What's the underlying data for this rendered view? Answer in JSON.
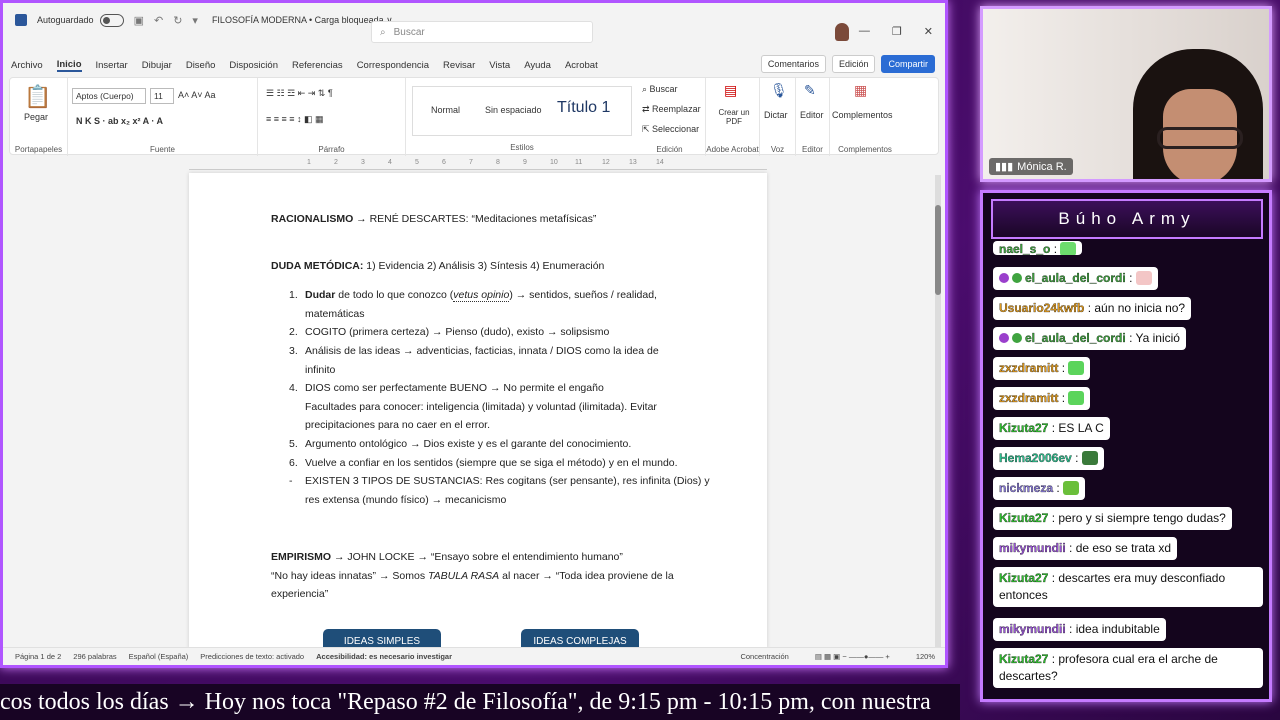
{
  "word": {
    "autosave_label": "Autoguardado",
    "doc_title": "FILOSOFÍA MODERNA • Carga bloqueada ∨",
    "search_placeholder": "Buscar",
    "menus": [
      "Archivo",
      "Inicio",
      "Insertar",
      "Dibujar",
      "Diseño",
      "Disposición",
      "Referencias",
      "Correspondencia",
      "Revisar",
      "Vista",
      "Ayuda",
      "Acrobat"
    ],
    "comments_label": "Comentarios",
    "editing_label": "Edición",
    "share_label": "Compartir",
    "ribbon": {
      "paste": "Pegar",
      "clipboard": "Portapapeles",
      "font_name": "Aptos (Cuerpo)",
      "font_size": "11",
      "font_group": "Fuente",
      "paragraph_group": "Párrafo",
      "style_normal": "Normal",
      "style_nospacing": "Sin espaciado",
      "style_title": "Título 1",
      "styles_group": "Estilos",
      "find": "Buscar",
      "replace": "Reemplazar",
      "select": "Seleccionar",
      "edit_group": "Edición",
      "create_pdf": "Crear un PDF",
      "acrobat_group": "Adobe Acrobat",
      "dictate": "Dictar",
      "voice_group": "Voz",
      "editor": "Editor",
      "editor_group": "Editor",
      "addins": "Complementos",
      "addins_group": "Complementos"
    },
    "ruler": [
      "1",
      "2",
      "3",
      "4",
      "5",
      "6",
      "7",
      "8",
      "9",
      "10",
      "11",
      "12",
      "13",
      "14"
    ],
    "document": {
      "l1_bold": "RACIONALISMO",
      "l1_rest": " → RENÉ DESCARTES: “Meditaciones metafísicas”",
      "l2_bold": "DUDA METÓDICA:",
      "l2_rest": " 1) Evidencia 2) Análisis 3) Síntesis 4) Enumeración",
      "items": [
        {
          "n": "1.",
          "pre_bold": "Dudar",
          "a": " de todo lo que conozco (",
          "italic": "vetus opinio",
          "b": ") → sentidos, sueños / realidad,",
          "cont": "matemáticas"
        },
        {
          "n": "2.",
          "text": "COGITO (primera certeza) → Pienso (dudo), existo → solipsismo"
        },
        {
          "n": "3.",
          "text": "Análisis de las ideas → adventicias, facticias, innata / DIOS como la idea de",
          "cont": "infinito"
        },
        {
          "n": "4.",
          "text": "DIOS como ser perfectamente BUENO → No permite el engaño",
          "cont": "Facultades para conocer: inteligencia (limitada) y voluntad (ilimitada). Evitar",
          "cont2": "precipitaciones para no caer en el error."
        },
        {
          "n": "5.",
          "text": "Argumento ontológico → Dios existe y es el garante del conocimiento."
        },
        {
          "n": "6.",
          "text": "Vuelve a confiar en los sentidos (siempre que se siga el método) y en el mundo."
        },
        {
          "n": "-",
          "text": "EXISTEN 3 TIPOS DE SUSTANCIAS: Res cogitans (ser pensante), res infinita (Dios) y",
          "cont": "res extensa (mundo físico) → mecanicismo"
        }
      ],
      "emp_bold": "EMPIRISMO",
      "emp_rest": " → JOHN LOCKE → “Ensayo sobre el entendimiento humano”",
      "emp2a": "“No hay ideas innatas” → Somos ",
      "emp2_italic": "TABULA RASA",
      "emp2b": " al nacer → “Toda idea proviene de la",
      "emp3": "experiencia”",
      "box1": "IDEAS SIMPLES",
      "box2": "IDEAS COMPLEJAS"
    },
    "status": {
      "page": "Página 1 de 2",
      "words": "296 palabras",
      "lang": "Español (España)",
      "predict": "Predicciones de texto: activado",
      "access": "Accesibilidad: es necesario investigar",
      "focus": "Concentración",
      "zoom": "120%"
    }
  },
  "cam": {
    "name": "Mónica R."
  },
  "chat": {
    "title": "Búho Army",
    "messages": [
      {
        "user": "nael_s_o",
        "color": "#3fa33f",
        "text": ":"
      },
      {
        "user": "el_aula_del_cordi",
        "color": "#3fa33f",
        "text": ":"
      },
      {
        "user": "Usuario24kwfb",
        "color": "#e09a1e",
        "text": ": aún no inicia no?"
      },
      {
        "user": "el_aula_del_cordi",
        "color": "#3fa33f",
        "text": ": Ya inició"
      },
      {
        "user": "zxzdramitt",
        "color": "#e09a1e",
        "text": ":"
      },
      {
        "user": "zxzdramitt",
        "color": "#e09a1e",
        "text": ":"
      },
      {
        "user": "Kizuta27",
        "color": "#2fbf2f",
        "text": ": ES LA C"
      },
      {
        "user": "Hema2006ev",
        "color": "#2fbf8f",
        "text": ":"
      },
      {
        "user": "nickmeza",
        "color": "#8a7bd8",
        "text": ":"
      },
      {
        "user": "Kizuta27",
        "color": "#2fbf2f",
        "text": ": pero y si siempre tengo dudas?"
      },
      {
        "user": "mikymundii",
        "color": "#9a55d6",
        "text": ": de eso se trata xd"
      },
      {
        "user": "Kizuta27",
        "color": "#2fbf2f",
        "text": ": descartes era muy desconfiado",
        "text2": "entonces"
      },
      {
        "user": "mikymundii",
        "color": "#9a55d6",
        "text": ": idea indubitable"
      },
      {
        "user": "Kizuta27",
        "color": "#2fbf2f",
        "text": ": profesora cual era el arche de",
        "text2": "descartes?"
      }
    ]
  },
  "ticker": "cos todos los días  →  Hoy nos toca \"Repaso #2 de Filosofía\", de 9:15 pm - 10:15 pm, con nuestra"
}
